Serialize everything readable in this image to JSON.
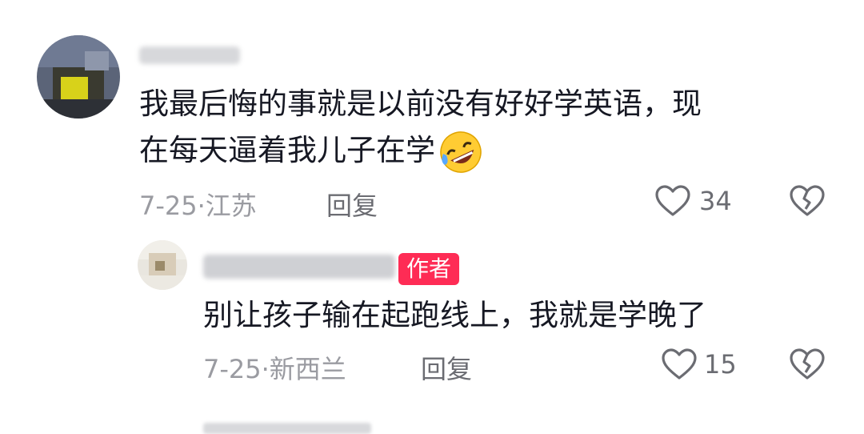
{
  "comment": {
    "text_line1": "我最后悔的事就是以前没有好好学英语，现",
    "text_line2": "在每天逼着我儿子在学",
    "emoji_icon": "rolling-on-floor-laughing-icon",
    "date_location": "7-25·江苏",
    "reply_label": "回复",
    "likes": "34"
  },
  "reply": {
    "badge": "作者",
    "text": "别让孩子输在起跑线上，我就是学晚了",
    "date_location": "7-25·新西兰",
    "reply_label": "回复",
    "likes": "15"
  },
  "colors": {
    "badge": "#fe2c55",
    "text": "#161823",
    "meta": "#9a9ba1"
  }
}
